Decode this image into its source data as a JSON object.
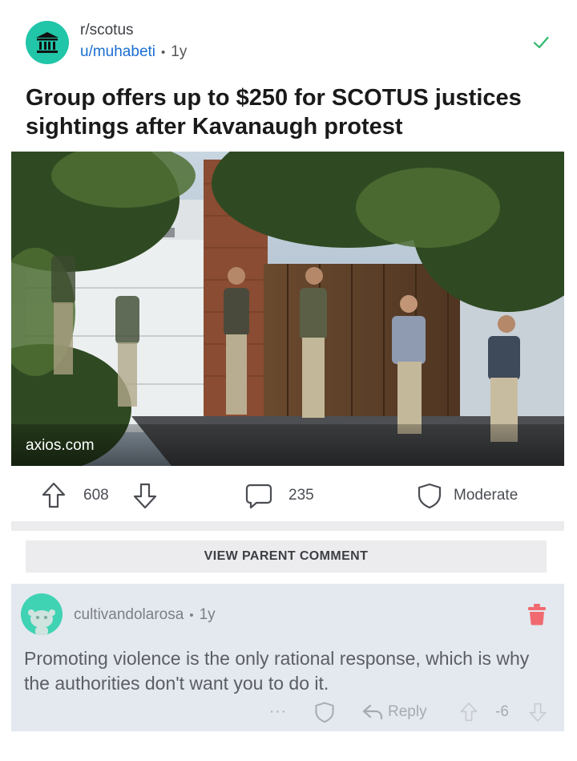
{
  "post": {
    "subreddit": "r/scotus",
    "author": "u/muhabeti",
    "age": "1y",
    "title": "Group offers up to $250 for SCOTUS justices sightings after Kavanaugh protest",
    "domain": "axios.com"
  },
  "actions": {
    "upvotes": "608",
    "comments": "235",
    "moderate_label": "Moderate"
  },
  "view_parent_label": "VIEW PARENT COMMENT",
  "comment": {
    "username": "cultivandolarosa",
    "age": "1y",
    "body": "Promoting violence is the only rational response, which is why the authorities don't want you to do it.",
    "more_label": "···",
    "reply_label": "Reply",
    "score": "-6"
  },
  "colors": {
    "subreddit_avatar": "#21c5a8",
    "author_link": "#1a6fd1",
    "approved_check": "#2eb86b",
    "trash": "#f06a6f",
    "comment_bg": "#e4e8ef"
  },
  "icons": [
    "columns-building-icon",
    "checkmark-icon",
    "upvote-arrow-icon",
    "downvote-arrow-icon",
    "comment-bubble-icon",
    "shield-icon",
    "trash-icon",
    "reply-arrow-icon"
  ]
}
